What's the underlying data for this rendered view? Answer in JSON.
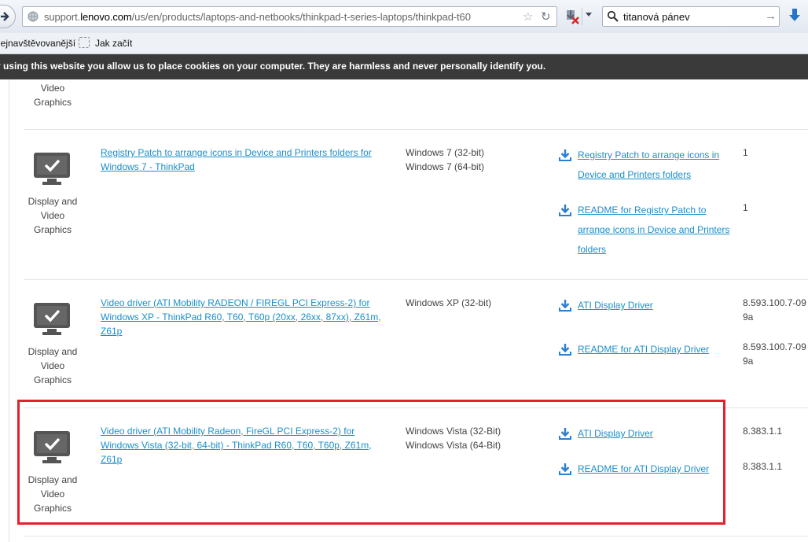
{
  "browser": {
    "url_host_prefix": "support.",
    "url_host_domain": "lenovo.com",
    "url_path": "/us/en/products/laptops-and-netbooks/thinkpad-t-series-laptops/thinkpad-t60",
    "search_value": "titanová pánev",
    "bookmarks": [
      "lejnavštěvovanější",
      "Jak začít"
    ]
  },
  "cookie_banner": {
    "text": "y using this website you allow us to place cookies on your computer. They are harmless and never personally identify you."
  },
  "rows": [
    {
      "category": [
        "Video",
        "Graphics"
      ],
      "description": "",
      "os": [],
      "files": [],
      "versions": []
    },
    {
      "category": [
        "Display and",
        "Video",
        "Graphics"
      ],
      "description": "Registry Patch to arrange icons in Device and Printers folders for Windows 7 - ThinkPad",
      "os": [
        "Windows 7 (32-bit)",
        "Windows 7 (64-bit)"
      ],
      "files": [
        "Registry Patch to arrange icons in Device and Printers folders",
        "README for Registry Patch to arrange icons in Device and Printers folders"
      ],
      "versions": [
        "1",
        "1"
      ]
    },
    {
      "category": [
        "Display and",
        "Video",
        "Graphics"
      ],
      "description": "Video driver (ATI Mobility RADEON / FIREGL PCI Express-2) for Windows XP - ThinkPad R60, T60, T60p (20xx, 26xx, 87xx), Z61m, Z61p",
      "os": [
        "Windows XP (32-bit)"
      ],
      "files": [
        "ATI Display Driver",
        "README for ATI Display Driver"
      ],
      "versions": [
        "8.593.100.7-09 9a",
        "8.593.100.7-09 9a"
      ]
    },
    {
      "category": [
        "Display and",
        "Video",
        "Graphics"
      ],
      "description": "Video driver (ATI Mobility Radeon, FireGL PCI Express-2) for Windows Vista (32-bit, 64-bit) - ThinkPad R60, T60, T60p, Z61m, Z61p",
      "os": [
        "Windows Vista (32-Bit)",
        "Windows Vista (64-Bit)"
      ],
      "files": [
        "ATI Display Driver",
        "README for ATI Display Driver"
      ],
      "versions": [
        "8.383.1.1",
        "8.383.1.1"
      ]
    }
  ],
  "colors": {
    "link": "#1a8fc9",
    "highlight": "#e0222c",
    "banner": "#3a3a3a"
  }
}
